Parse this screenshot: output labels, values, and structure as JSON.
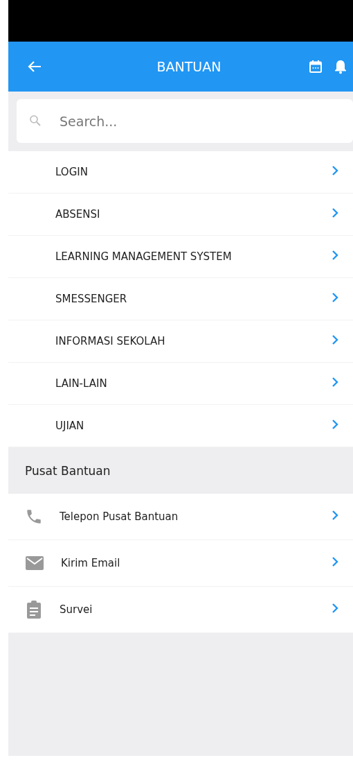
{
  "app_bar": {
    "title": "BANTUAN"
  },
  "search": {
    "placeholder": "Search..."
  },
  "topics": [
    {
      "label": "LOGIN"
    },
    {
      "label": "ABSENSI"
    },
    {
      "label": "LEARNING MANAGEMENT SYSTEM"
    },
    {
      "label": "SMESSENGER"
    },
    {
      "label": "INFORMASI SEKOLAH"
    },
    {
      "label": "LAIN-LAIN"
    },
    {
      "label": "UJIAN"
    }
  ],
  "help_center": {
    "heading": "Pusat Bantuan",
    "items": [
      {
        "label": "Telepon Pusat Bantuan"
      },
      {
        "label": "Kirim Email"
      },
      {
        "label": "Survei"
      }
    ]
  }
}
